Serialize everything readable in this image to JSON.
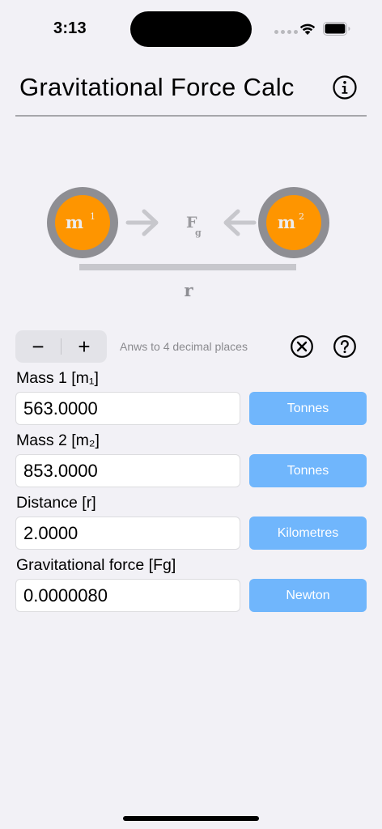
{
  "status_bar": {
    "time": "3:13"
  },
  "header": {
    "title": "Gravitational Force Calc",
    "info_icon": "info-circle-icon"
  },
  "diagram": {
    "mass1_label": "m",
    "mass1_sup": "1",
    "mass2_label": "m",
    "mass2_sup": "2",
    "force_label": "F",
    "force_sub": "g",
    "distance_label": "r",
    "colors": {
      "mass_fill": "#fe9500",
      "mass_ring": "#8e8e93",
      "arrow": "#c7c7cc",
      "bar": "#c7c7cc"
    }
  },
  "controls": {
    "minus_label": "−",
    "plus_label": "+",
    "decimal_note": "Anws to 4 decimal places",
    "clear_icon": "clear-circle-icon",
    "help_icon": "help-circle-icon"
  },
  "fields": [
    {
      "label": "Mass 1 [m₁]",
      "value": "563.0000",
      "unit": "Tonnes"
    },
    {
      "label": "Mass 2 [m₂]",
      "value": "853.0000",
      "unit": "Tonnes"
    },
    {
      "label": "Distance [r]",
      "value": "2.0000",
      "unit": "Kilometres"
    },
    {
      "label": "Gravitational force [Fg]",
      "value": "0.0000080",
      "unit": "Newton"
    }
  ],
  "colors": {
    "background": "#f2f1f6",
    "accent": "#70b6fc"
  }
}
